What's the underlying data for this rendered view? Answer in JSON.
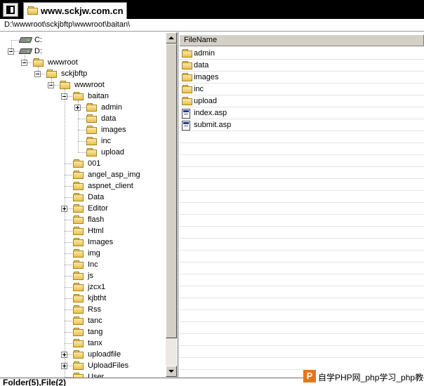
{
  "tab": {
    "title": "www.sckjw.com.cn"
  },
  "address": "D:\\wwwroot\\sckjbftp\\wwwroot\\baitan\\",
  "tree": [
    {
      "label": "C:",
      "icon": "drive-icon",
      "level": 0
    },
    {
      "label": "D:",
      "icon": "drive-icon",
      "level": 0,
      "expanded": true
    },
    {
      "label": "wwwroot",
      "icon": "folder-icon",
      "level": 1,
      "expanded": true
    },
    {
      "label": "sckjbftp",
      "icon": "folder-icon",
      "level": 2,
      "expanded": true
    },
    {
      "label": "wwwroot",
      "icon": "folder-icon",
      "level": 3,
      "expanded": true
    },
    {
      "label": "baitan",
      "icon": "folder-icon",
      "level": 4,
      "expanded": true
    },
    {
      "label": "admin",
      "icon": "folder-icon",
      "level": 5,
      "collapsed": true
    },
    {
      "label": "data",
      "icon": "folder-icon",
      "level": 5
    },
    {
      "label": "images",
      "icon": "folder-icon",
      "level": 5
    },
    {
      "label": "inc",
      "icon": "folder-icon",
      "level": 5
    },
    {
      "label": "upload",
      "icon": "folder-icon",
      "level": 5
    },
    {
      "label": "001",
      "icon": "folder-icon",
      "level": 4
    },
    {
      "label": "angel_asp_img",
      "icon": "folder-icon",
      "level": 4
    },
    {
      "label": "aspnet_client",
      "icon": "folder-icon",
      "level": 4
    },
    {
      "label": "Data",
      "icon": "folder-icon",
      "level": 4
    },
    {
      "label": "Editor",
      "icon": "folder-icon",
      "level": 4,
      "collapsed": true
    },
    {
      "label": "flash",
      "icon": "folder-icon",
      "level": 4
    },
    {
      "label": "Html",
      "icon": "folder-icon",
      "level": 4
    },
    {
      "label": "Images",
      "icon": "folder-icon",
      "level": 4
    },
    {
      "label": "img",
      "icon": "folder-icon",
      "level": 4
    },
    {
      "label": "Inc",
      "icon": "folder-icon",
      "level": 4
    },
    {
      "label": "js",
      "icon": "folder-icon",
      "level": 4
    },
    {
      "label": "jzcx1",
      "icon": "folder-icon",
      "level": 4
    },
    {
      "label": "kjbtht",
      "icon": "folder-icon",
      "level": 4
    },
    {
      "label": "Rss",
      "icon": "folder-icon",
      "level": 4
    },
    {
      "label": "tanc",
      "icon": "folder-icon",
      "level": 4
    },
    {
      "label": "tang",
      "icon": "folder-icon",
      "level": 4
    },
    {
      "label": "tanx",
      "icon": "folder-icon",
      "level": 4
    },
    {
      "label": "uploadfile",
      "icon": "folder-icon",
      "level": 4,
      "collapsed": true
    },
    {
      "label": "UploadFiles",
      "icon": "folder-icon",
      "level": 4,
      "collapsed": true
    },
    {
      "label": "User",
      "icon": "folder-icon",
      "level": 4
    }
  ],
  "filelist": {
    "column": "FileName",
    "items": [
      {
        "name": "admin",
        "icon": "folder-icon"
      },
      {
        "name": "data",
        "icon": "folder-icon"
      },
      {
        "name": "images",
        "icon": "folder-icon"
      },
      {
        "name": "inc",
        "icon": "folder-icon"
      },
      {
        "name": "upload",
        "icon": "folder-icon"
      },
      {
        "name": "index.asp",
        "icon": "document-icon"
      },
      {
        "name": "submit.asp",
        "icon": "document-icon"
      }
    ]
  },
  "status": "Folder(5),File(2)",
  "watermark": {
    "logo": "P",
    "text": "自学PHP网_php学习_php教"
  }
}
